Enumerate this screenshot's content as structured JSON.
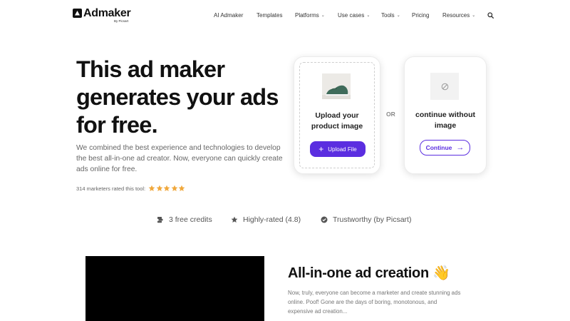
{
  "nav": {
    "logo": "Admaker",
    "logo_sub": "By Picsart",
    "links": [
      {
        "label": "AI Admaker",
        "dropdown": false
      },
      {
        "label": "Templates",
        "dropdown": false
      },
      {
        "label": "Platforms",
        "dropdown": true
      },
      {
        "label": "Use cases",
        "dropdown": true
      },
      {
        "label": "Tools",
        "dropdown": true
      },
      {
        "label": "Pricing",
        "dropdown": false
      },
      {
        "label": "Resources",
        "dropdown": true
      }
    ],
    "search_icon": "search-icon"
  },
  "hero": {
    "title": "This ad maker generates your ads for free.",
    "description": "We combined the best experience and technologies to develop the best all-in-one ad creator. Now, everyone can quickly create ads online for free.",
    "rating_text": "314 marketers rated this tool:",
    "stars": 5
  },
  "upload_card": {
    "label": "Upload your product image",
    "button": "Upload File"
  },
  "or_label": "OR",
  "no_image_card": {
    "label": "continue without image",
    "button": "Continue"
  },
  "features": [
    {
      "icon": "credits-icon",
      "label": "3 free credits"
    },
    {
      "icon": "star-icon",
      "label": "Highly-rated (4.8)"
    },
    {
      "icon": "check-badge-icon",
      "label": "Trustworthy (by Picsart)"
    }
  ],
  "section": {
    "title": "All-in-one ad creation 👋",
    "description": "Now, truly, everyone can become a marketer and create stunning ads online. Poof! Gone are the days of boring, monotonous, and expensive ad creation..."
  },
  "colors": {
    "accent": "#5b2ee0",
    "star": "#f0a83c"
  }
}
